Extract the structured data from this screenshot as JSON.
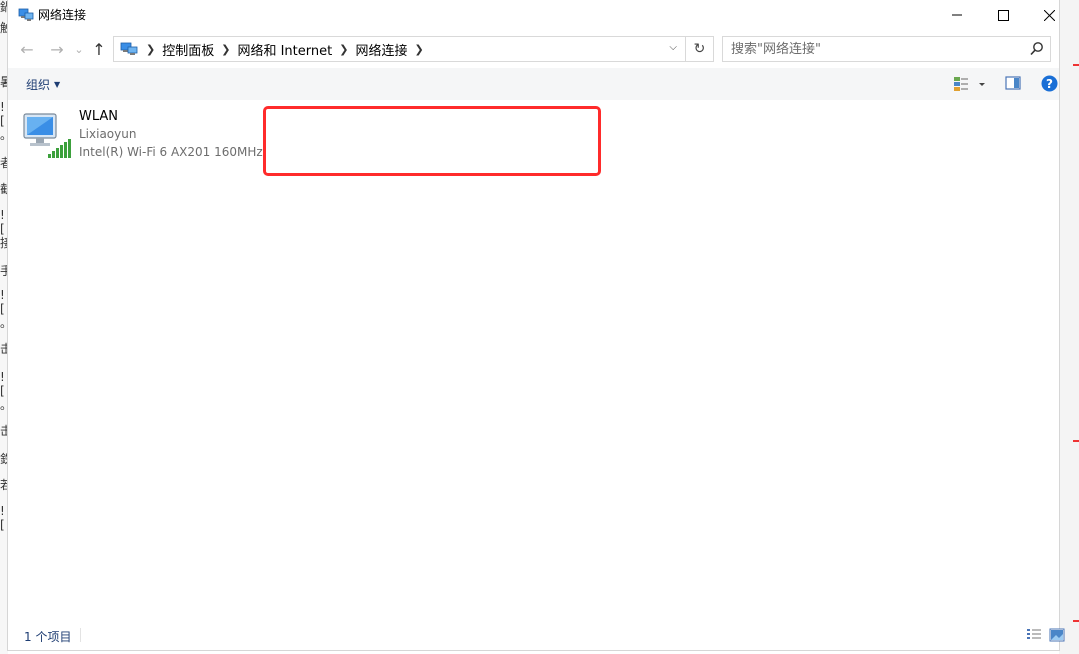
{
  "window": {
    "title": "网络连接"
  },
  "nav": {
    "back": "←",
    "forward": "→",
    "recent": "⌄",
    "up": "↑"
  },
  "breadcrumb": [
    {
      "label": "控制面板"
    },
    {
      "label": "网络和 Internet"
    },
    {
      "label": "网络连接"
    }
  ],
  "search": {
    "placeholder": "搜索\"网络连接\""
  },
  "toolbar": {
    "organize_label": "组织"
  },
  "connections": [
    {
      "name": "WLAN",
      "ssid": "Lixiaoyun",
      "adapter": "Intel(R) Wi-Fi 6 AX201 160MHz"
    }
  ],
  "status": {
    "item_count": "1 个项目"
  },
  "background": {
    "left_glyphs": [
      "鍋",
      "触",
      "暑",
      "![",
      "。",
      "者",
      "截",
      "![",
      "接",
      "手",
      "![",
      "。",
      "击",
      "![",
      "。",
      "击",
      "鉄",
      "若",
      "!["
    ]
  },
  "colors": {
    "accent": "#1e3d73",
    "highlight": "#ff2b2b",
    "toolbar_bg": "#f5f6f7",
    "help": "#1a6fd6"
  }
}
